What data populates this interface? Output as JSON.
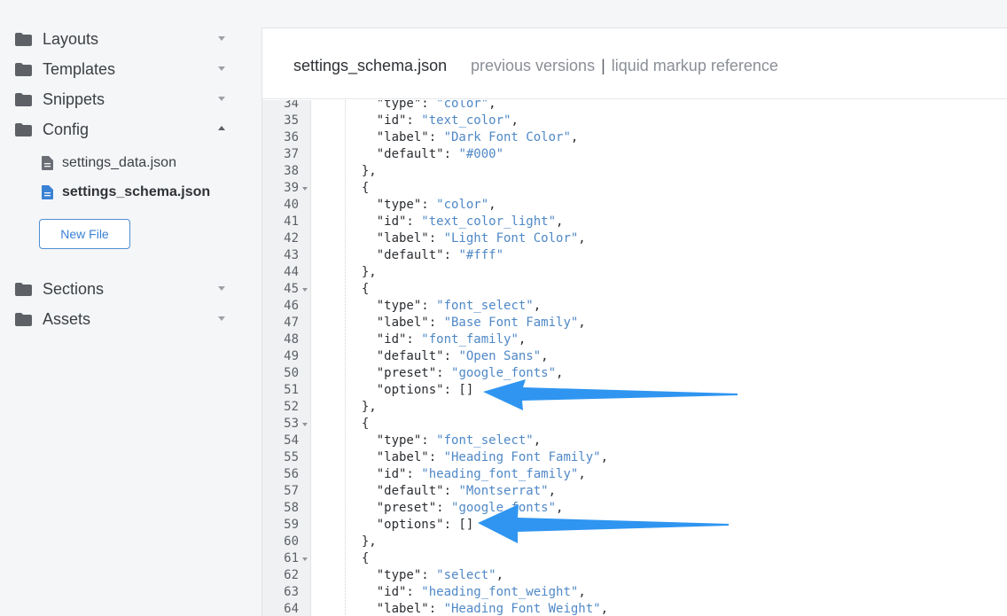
{
  "sidebar": {
    "folders": [
      {
        "label": "Layouts",
        "icon": "folder-icon",
        "expanded": false
      },
      {
        "label": "Templates",
        "icon": "folder-icon",
        "expanded": false
      },
      {
        "label": "Snippets",
        "icon": "folder-icon",
        "expanded": false
      },
      {
        "label": "Config",
        "icon": "folder-icon",
        "expanded": true
      },
      {
        "label": "Sections",
        "icon": "folder-icon",
        "expanded": false
      },
      {
        "label": "Assets",
        "icon": "folder-icon",
        "expanded": false
      }
    ],
    "config_files": [
      {
        "label": "settings_data.json",
        "icon": "file-icon",
        "active": false
      },
      {
        "label": "settings_schema.json",
        "icon": "file-icon",
        "active": true
      }
    ],
    "new_file_label": "New File"
  },
  "editor": {
    "file_title": "settings_schema.json",
    "link_previous": "previous versions",
    "separator": "|",
    "link_reference": "liquid markup reference"
  },
  "code": {
    "lines": [
      {
        "n": "34",
        "fold": false,
        "text": "    \"type\": \"color\","
      },
      {
        "n": "35",
        "fold": false,
        "text": "    \"id\": \"text_color\","
      },
      {
        "n": "36",
        "fold": false,
        "text": "    \"label\": \"Dark Font Color\","
      },
      {
        "n": "37",
        "fold": false,
        "text": "    \"default\": \"#000\""
      },
      {
        "n": "38",
        "fold": false,
        "text": "  },"
      },
      {
        "n": "39",
        "fold": true,
        "text": "  {"
      },
      {
        "n": "40",
        "fold": false,
        "text": "    \"type\": \"color\","
      },
      {
        "n": "41",
        "fold": false,
        "text": "    \"id\": \"text_color_light\","
      },
      {
        "n": "42",
        "fold": false,
        "text": "    \"label\": \"Light Font Color\","
      },
      {
        "n": "43",
        "fold": false,
        "text": "    \"default\": \"#fff\""
      },
      {
        "n": "44",
        "fold": false,
        "text": "  },"
      },
      {
        "n": "45",
        "fold": true,
        "text": "  {"
      },
      {
        "n": "46",
        "fold": false,
        "text": "    \"type\": \"font_select\","
      },
      {
        "n": "47",
        "fold": false,
        "text": "    \"label\": \"Base Font Family\","
      },
      {
        "n": "48",
        "fold": false,
        "text": "    \"id\": \"font_family\","
      },
      {
        "n": "49",
        "fold": false,
        "text": "    \"default\": \"Open Sans\","
      },
      {
        "n": "50",
        "fold": false,
        "text": "    \"preset\": \"google_fonts\","
      },
      {
        "n": "51",
        "fold": false,
        "text": "    \"options\": []"
      },
      {
        "n": "52",
        "fold": false,
        "text": "  },"
      },
      {
        "n": "53",
        "fold": true,
        "text": "  {"
      },
      {
        "n": "54",
        "fold": false,
        "text": "    \"type\": \"font_select\","
      },
      {
        "n": "55",
        "fold": false,
        "text": "    \"label\": \"Heading Font Family\","
      },
      {
        "n": "56",
        "fold": false,
        "text": "    \"id\": \"heading_font_family\","
      },
      {
        "n": "57",
        "fold": false,
        "text": "    \"default\": \"Montserrat\","
      },
      {
        "n": "58",
        "fold": false,
        "text": "    \"preset\": \"google_fonts\","
      },
      {
        "n": "59",
        "fold": false,
        "text": "    \"options\": []"
      },
      {
        "n": "60",
        "fold": false,
        "text": "  },"
      },
      {
        "n": "61",
        "fold": true,
        "text": "  {"
      },
      {
        "n": "62",
        "fold": false,
        "text": "    \"type\": \"select\","
      },
      {
        "n": "63",
        "fold": false,
        "text": "    \"id\": \"heading_font_weight\","
      },
      {
        "n": "64",
        "fold": false,
        "text": "    \"label\": \"Heading Font Weight\","
      }
    ]
  },
  "colors": {
    "accent": "#2f95f0",
    "string": "#4f88c6",
    "link": "#3a82d4"
  }
}
